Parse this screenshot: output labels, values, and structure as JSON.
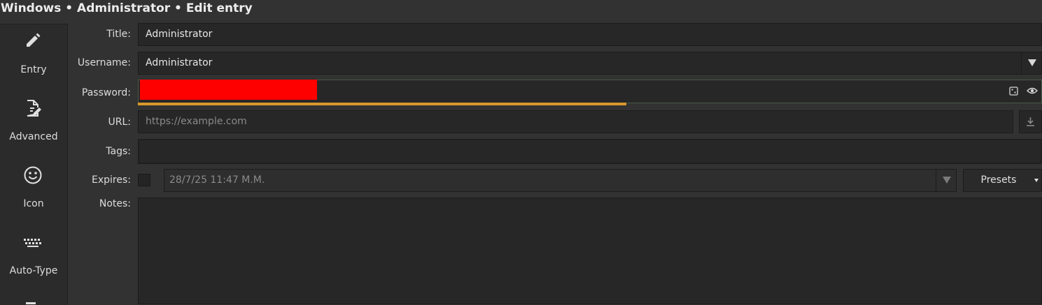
{
  "window": {
    "title": "Windows • Administrator • Edit entry"
  },
  "sidebar": {
    "items": [
      {
        "label": "Entry",
        "icon": "pencil-icon"
      },
      {
        "label": "Advanced",
        "icon": "document-edit-icon"
      },
      {
        "label": "Icon",
        "icon": "smiley-icon"
      },
      {
        "label": "Auto-Type",
        "icon": "keyboard-icon"
      }
    ]
  },
  "form": {
    "title": {
      "label": "Title:",
      "value": "Administrator"
    },
    "username": {
      "label": "Username:",
      "value": "Administrator"
    },
    "password": {
      "label": "Password:",
      "value": "",
      "redacted": true,
      "strength_fraction": 0.54,
      "strength_color": "#d9982a"
    },
    "url": {
      "label": "URL:",
      "value": "",
      "placeholder": "https://example.com"
    },
    "tags": {
      "label": "Tags:",
      "value": ""
    },
    "expires": {
      "label": "Expires:",
      "checked": false,
      "value": "28/7/25 11:47 M.M.",
      "presets_label": "Presets"
    },
    "notes": {
      "label": "Notes:",
      "value": ""
    }
  },
  "colors": {
    "background": "#323232",
    "field": "#272728",
    "redaction": "#ff0000"
  }
}
